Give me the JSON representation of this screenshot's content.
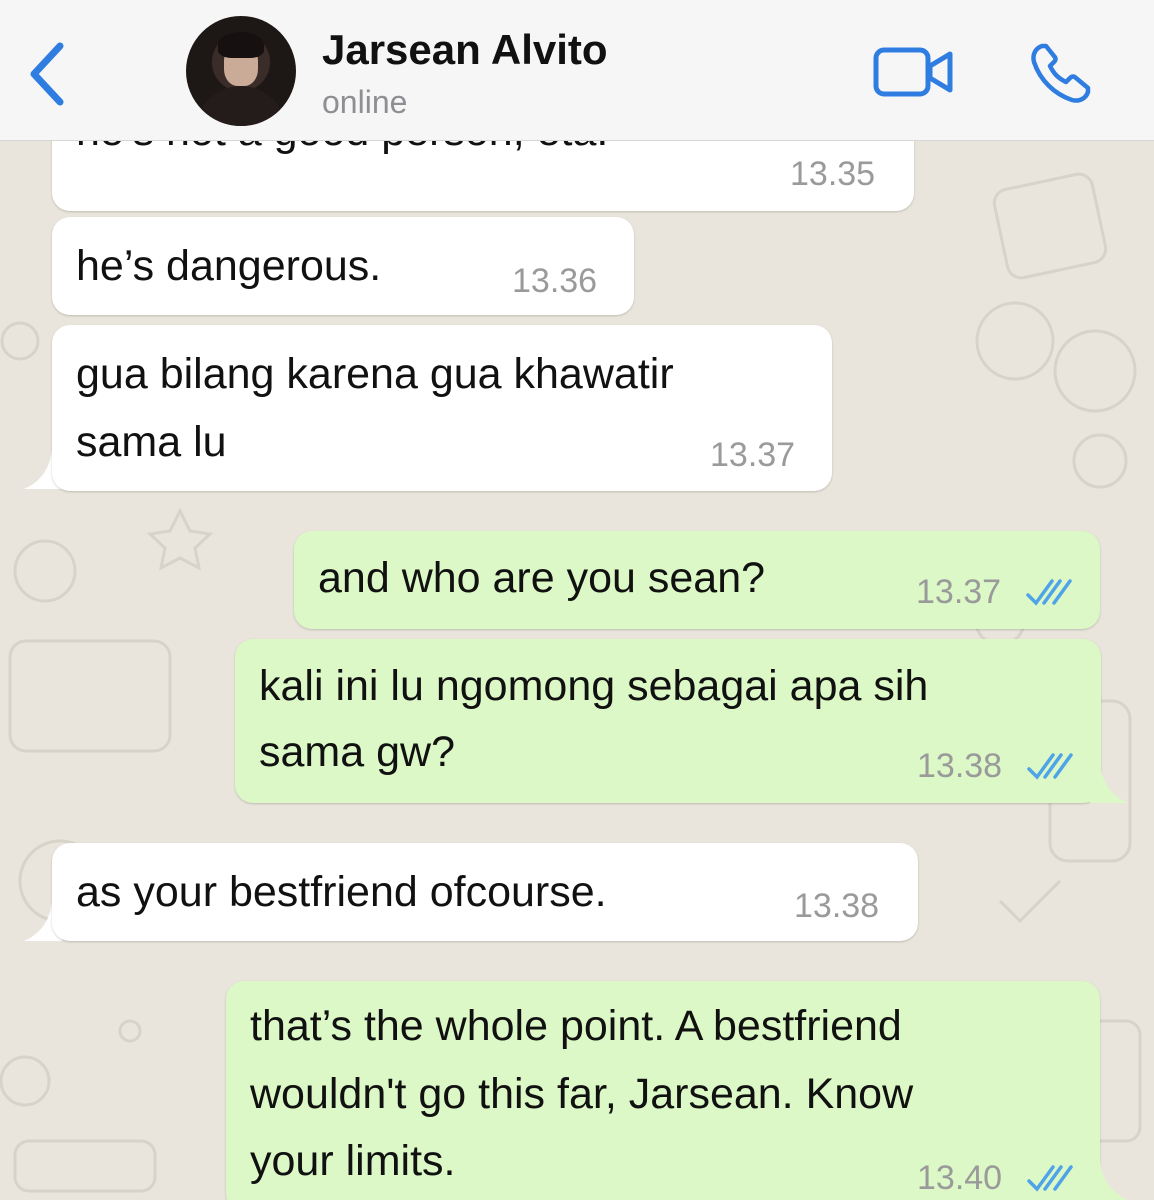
{
  "header": {
    "contact_name": "Jarsean Alvito",
    "status": "online",
    "accent_color": "#2f7de1"
  },
  "messages": [
    {
      "direction": "incoming",
      "lines": [
        "he’s not a good person, eta."
      ],
      "time": "13.35"
    },
    {
      "direction": "incoming",
      "lines": [
        "he’s dangerous."
      ],
      "time": "13.36"
    },
    {
      "direction": "incoming",
      "lines": [
        "gua bilang karena gua khawatir",
        "sama lu"
      ],
      "time": "13.37"
    },
    {
      "direction": "outgoing",
      "lines": [
        "and who are you sean?"
      ],
      "time": "13.37",
      "read": true
    },
    {
      "direction": "outgoing",
      "lines": [
        "kali ini lu ngomong sebagai apa sih",
        "sama gw?"
      ],
      "time": "13.38",
      "read": true
    },
    {
      "direction": "incoming",
      "lines": [
        "as your bestfriend ofcourse."
      ],
      "time": "13.38"
    },
    {
      "direction": "outgoing",
      "lines": [
        "that’s the whole point. A bestfriend",
        "wouldn't go this far, Jarsean. Know",
        "your limits."
      ],
      "time": "13.40",
      "read": true
    }
  ],
  "colors": {
    "incoming_bubble": "#ffffff",
    "outgoing_bubble": "#dcf8c6",
    "wallpaper": "#e9e5dc",
    "read_ticks": "#4fa3e8"
  },
  "icons": [
    "chevron-left-icon",
    "video-camera-icon",
    "phone-icon",
    "double-check-icon"
  ]
}
